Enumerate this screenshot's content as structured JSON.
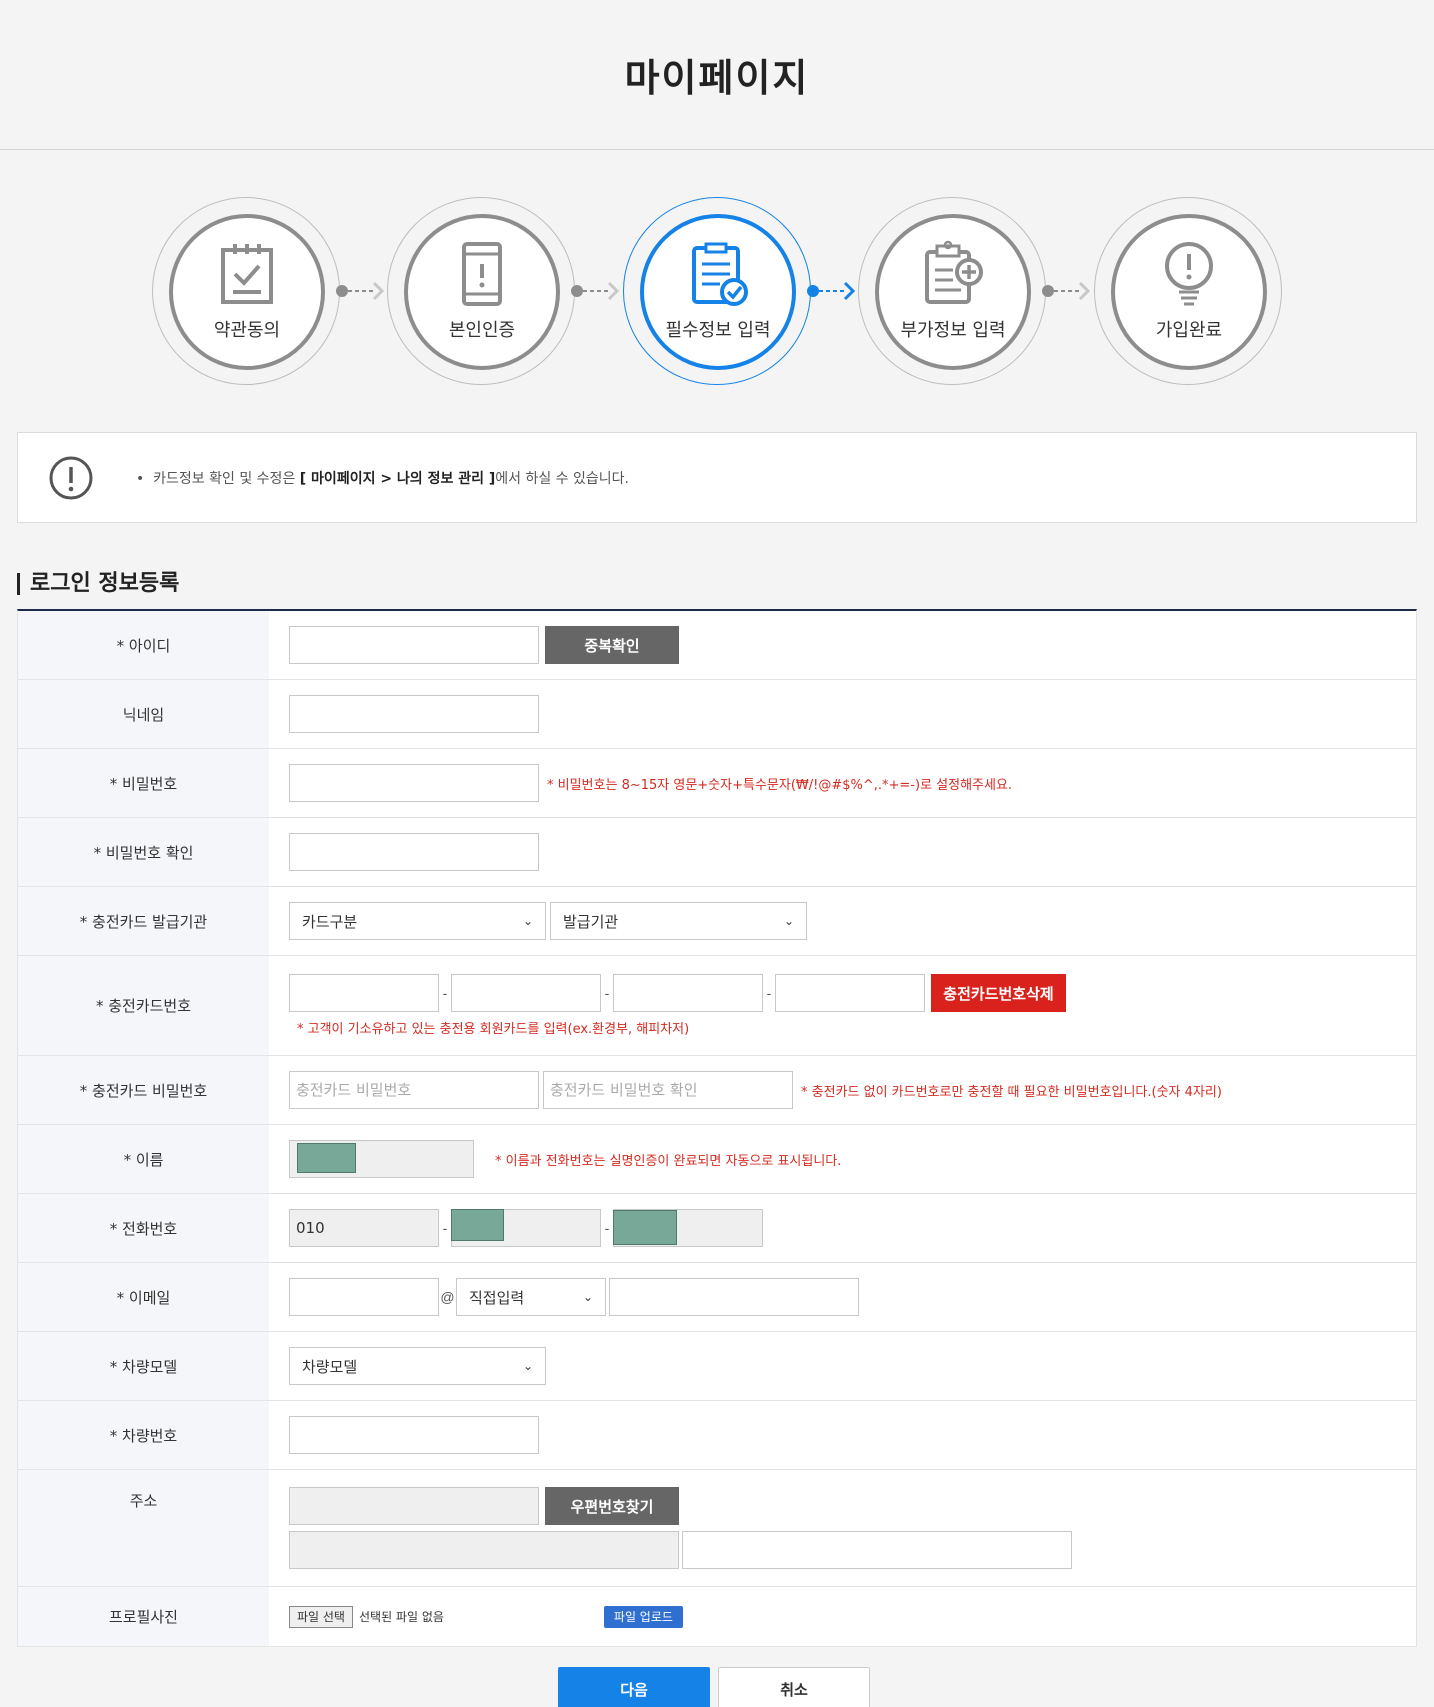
{
  "header": {
    "title": "마이페이지"
  },
  "steps": [
    {
      "label": "약관동의",
      "icon": "notepad-check-icon",
      "active": false
    },
    {
      "label": "본인인증",
      "icon": "phone-alert-icon",
      "active": false
    },
    {
      "label": "필수정보 입력",
      "icon": "clipboard-check-icon",
      "active": true
    },
    {
      "label": "부가정보 입력",
      "icon": "clipboard-plus-icon",
      "active": false
    },
    {
      "label": "가입완료",
      "icon": "lightbulb-icon",
      "active": false
    }
  ],
  "notice": {
    "bullet": "•",
    "prefix": "카드정보 확인 및 수정은 ",
    "path": "[ 마이페이지 > 나의 정보 관리 ]",
    "suffix": "에서 하실 수 있습니다."
  },
  "section": {
    "title": "로그인 정보등록"
  },
  "form": {
    "id": {
      "label": "* 아이디",
      "button": "중복확인"
    },
    "nickname": {
      "label": "닉네임"
    },
    "password": {
      "label": "* 비밀번호",
      "hint": "* 비밀번호는 8~15자 영문+숫자+특수문자(₩/!@#$%^,.*+=-)로 설정해주세요."
    },
    "password_confirm": {
      "label": "* 비밀번호 확인"
    },
    "card_issuer": {
      "label": "* 충전카드 발급기관",
      "select1": "카드구분",
      "select2": "발급기관"
    },
    "card_number": {
      "label": "* 충전카드번호",
      "button": "충전카드번호삭제",
      "hint": "* 고객이 기소유하고 있는 충전용 회원카드를 입력(ex.환경부, 해피차저)",
      "separator": "-"
    },
    "card_password": {
      "label": "* 충전카드 비밀번호",
      "placeholder1": "충전카드 비밀번호",
      "placeholder2": "충전카드 비밀번호 확인",
      "hint": "* 충전카드 없이 카드번호로만 충전할 때 필요한 비밀번호입니다.(숫자 4자리)"
    },
    "name": {
      "label": "* 이름",
      "hint": "* 이름과 전화번호는 실명인증이 완료되면 자동으로 표시됩니다."
    },
    "phone": {
      "label": "* 전화번호",
      "prefix": "010",
      "separator": "-"
    },
    "email": {
      "label": "* 이메일",
      "at": "@",
      "domain_select": "직접입력"
    },
    "car_model": {
      "label": "* 차량모델",
      "select": "차량모델"
    },
    "car_number": {
      "label": "* 차량번호"
    },
    "address": {
      "label": "주소",
      "button": "우편번호찾기"
    },
    "profile": {
      "label": "프로필사진",
      "file_button": "파일 선택",
      "file_status": "선택된 파일 없음",
      "upload_button": "파일 업로드"
    }
  },
  "actions": {
    "next": "다음",
    "cancel": "취소"
  },
  "colors": {
    "accent": "#1482e6",
    "danger": "#d9221c",
    "navy": "#1e2a4a"
  }
}
